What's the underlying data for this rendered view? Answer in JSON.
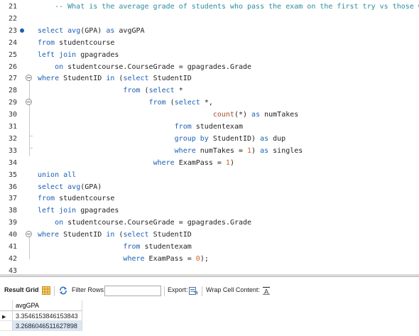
{
  "editor": {
    "lines": [
      {
        "n": "21",
        "tokens": [
          {
            "t": "    -- What is the average grade of students who pass the exam on the first try vs those who don't?",
            "c": "cmt"
          }
        ]
      },
      {
        "n": "22",
        "tokens": []
      },
      {
        "n": "23",
        "marker": true,
        "tokens": [
          {
            "t": "select ",
            "c": "kw"
          },
          {
            "t": "avg",
            "c": "kw"
          },
          {
            "t": "(GPA) "
          },
          {
            "t": "as",
            "c": "kw"
          },
          {
            "t": " avgGPA"
          }
        ]
      },
      {
        "n": "24",
        "tokens": [
          {
            "t": "from",
            "c": "kw"
          },
          {
            "t": " studentcourse"
          }
        ]
      },
      {
        "n": "25",
        "tokens": [
          {
            "t": "left join",
            "c": "kw"
          },
          {
            "t": " gpagrades"
          }
        ]
      },
      {
        "n": "26",
        "tokens": [
          {
            "t": "    "
          },
          {
            "t": "on",
            "c": "kw"
          },
          {
            "t": " studentcourse.CourseGrade = gpagrades.Grade"
          }
        ]
      },
      {
        "n": "27",
        "fold": true,
        "tokens": [
          {
            "t": "where",
            "c": "kw"
          },
          {
            "t": " StudentID "
          },
          {
            "t": "in",
            "c": "kw"
          },
          {
            "t": " ("
          },
          {
            "t": "select",
            "c": "kw"
          },
          {
            "t": " StudentID"
          }
        ]
      },
      {
        "n": "28",
        "tokens": [
          {
            "t": "                    "
          },
          {
            "t": "from",
            "c": "kw"
          },
          {
            "t": " ("
          },
          {
            "t": "select",
            "c": "kw"
          },
          {
            "t": " *"
          }
        ]
      },
      {
        "n": "29",
        "fold": true,
        "tokens": [
          {
            "t": "                          "
          },
          {
            "t": "from",
            "c": "kw"
          },
          {
            "t": " ("
          },
          {
            "t": "select",
            "c": "kw"
          },
          {
            "t": " *,"
          }
        ]
      },
      {
        "n": "30",
        "tokens": [
          {
            "t": "                                         "
          },
          {
            "t": "count",
            "c": "fn"
          },
          {
            "t": "(*) "
          },
          {
            "t": "as",
            "c": "kw"
          },
          {
            "t": " numTakes"
          }
        ]
      },
      {
        "n": "31",
        "tokens": [
          {
            "t": "                                "
          },
          {
            "t": "from",
            "c": "kw"
          },
          {
            "t": " studentexam"
          }
        ]
      },
      {
        "n": "32",
        "tokens": [
          {
            "t": "                                "
          },
          {
            "t": "group by",
            "c": "kw"
          },
          {
            "t": " StudentID) "
          },
          {
            "t": "as",
            "c": "kw"
          },
          {
            "t": " dup"
          }
        ]
      },
      {
        "n": "33",
        "tokens": [
          {
            "t": "                                "
          },
          {
            "t": "where",
            "c": "kw"
          },
          {
            "t": " numTakes = "
          },
          {
            "t": "1",
            "c": "num"
          },
          {
            "t": ") "
          },
          {
            "t": "as",
            "c": "kw"
          },
          {
            "t": " singles"
          }
        ]
      },
      {
        "n": "34",
        "tokens": [
          {
            "t": "                           "
          },
          {
            "t": "where",
            "c": "kw"
          },
          {
            "t": " ExamPass = "
          },
          {
            "t": "1",
            "c": "num"
          },
          {
            "t": ")"
          }
        ]
      },
      {
        "n": "35",
        "tokens": [
          {
            "t": "union all",
            "c": "kw"
          }
        ]
      },
      {
        "n": "36",
        "tokens": [
          {
            "t": "select ",
            "c": "kw"
          },
          {
            "t": "avg",
            "c": "kw"
          },
          {
            "t": "(GPA)"
          }
        ]
      },
      {
        "n": "37",
        "tokens": [
          {
            "t": "from",
            "c": "kw"
          },
          {
            "t": " studentcourse"
          }
        ]
      },
      {
        "n": "38",
        "tokens": [
          {
            "t": "left join",
            "c": "kw"
          },
          {
            "t": " gpagrades"
          }
        ]
      },
      {
        "n": "39",
        "tokens": [
          {
            "t": "    "
          },
          {
            "t": "on",
            "c": "kw"
          },
          {
            "t": " studentcourse.CourseGrade = gpagrades.Grade"
          }
        ]
      },
      {
        "n": "40",
        "fold": true,
        "tokens": [
          {
            "t": "where",
            "c": "kw"
          },
          {
            "t": " StudentID "
          },
          {
            "t": "in",
            "c": "kw"
          },
          {
            "t": " ("
          },
          {
            "t": "select",
            "c": "kw"
          },
          {
            "t": " StudentID"
          }
        ]
      },
      {
        "n": "41",
        "tokens": [
          {
            "t": "                    "
          },
          {
            "t": "from",
            "c": "kw"
          },
          {
            "t": " studentexam"
          }
        ]
      },
      {
        "n": "42",
        "tokens": [
          {
            "t": "                    "
          },
          {
            "t": "where",
            "c": "kw"
          },
          {
            "t": " ExamPass = "
          },
          {
            "t": "0",
            "c": "num"
          },
          {
            "t": ");"
          }
        ]
      },
      {
        "n": "43",
        "tokens": []
      }
    ]
  },
  "toolbar": {
    "result_grid_label": "Result Grid",
    "filter_label": "Filter Rows:",
    "filter_value": "",
    "export_label": "Export:",
    "wrap_label": "Wrap Cell Content:",
    "icons": {
      "grid": "grid-icon",
      "refresh": "refresh-icon",
      "export": "export-icon",
      "wrap": "wrap-icon"
    },
    "accent_color": "#e8a31c"
  },
  "grid": {
    "columns": [
      "avgGPA"
    ],
    "rows": [
      [
        "3.3546153846153843"
      ],
      [
        "3.2686046511627898"
      ]
    ],
    "selected_row": 0
  }
}
